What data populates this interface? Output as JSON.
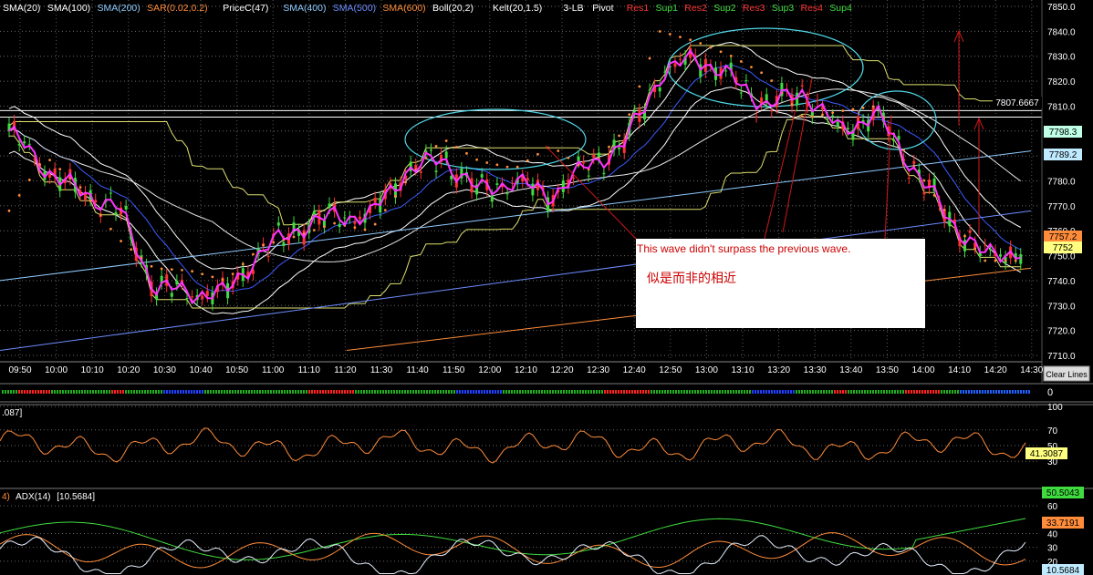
{
  "legend": [
    {
      "text": "SMA(20)",
      "color": "#ffffff"
    },
    {
      "text": "SMA(100)",
      "color": "#ffffff"
    },
    {
      "text": "SMA(200)",
      "color": "#8ecbff"
    },
    {
      "text": "SAR(0.02,0.2)",
      "color": "#ff8c3a"
    },
    {
      "text": "PriceC(47)",
      "color": "#ffffff"
    },
    {
      "text": "SMA(400)",
      "color": "#8ecbff"
    },
    {
      "text": "SMA(500)",
      "color": "#6d8cff"
    },
    {
      "text": "SMA(600)",
      "color": "#ff8c3a"
    },
    {
      "text": "Boll(20,2)",
      "color": "#ffffff"
    },
    {
      "text": "Kelt(20,1.5)",
      "color": "#ffffff"
    },
    {
      "text": "3-LB",
      "color": "#ffffff"
    },
    {
      "text": "Pivot",
      "color": "#ffffff"
    },
    {
      "text": "Res1",
      "color": "#ff3333"
    },
    {
      "text": "Sup1",
      "color": "#3fdc3f"
    },
    {
      "text": "Res2",
      "color": "#ff3333"
    },
    {
      "text": "Sup2",
      "color": "#3fdc3f"
    },
    {
      "text": "Res3",
      "color": "#ff3333"
    },
    {
      "text": "Sup3",
      "color": "#3fdc3f"
    },
    {
      "text": "Res4",
      "color": "#ff3333"
    },
    {
      "text": "Sup4",
      "color": "#3fdc3f"
    }
  ],
  "price_axis_ticks": [
    "7850.0",
    "7840.0",
    "7830.0",
    "7820.0",
    "7810.0",
    "7800.0",
    "7790.0",
    "7780.0",
    "7770.0",
    "7760.0",
    "7750.0",
    "7740.0",
    "7730.0",
    "7720.0",
    "7710.0"
  ],
  "price_tags": [
    {
      "text": "7807.6667",
      "bg": "#000000",
      "fg": "#ffffff"
    },
    {
      "text": "7798.3",
      "bg": "#bfffe6",
      "fg": "#000000"
    },
    {
      "text": "7789.2",
      "bg": "#bfeaff",
      "fg": "#000000"
    },
    {
      "text": "7757.2",
      "bg": "#ff8c3a",
      "fg": "#000000"
    },
    {
      "text": "7752",
      "bg": "#ffff80",
      "fg": "#000000"
    }
  ],
  "time_axis_ticks": [
    "09:50",
    "10:00",
    "10:10",
    "10:20",
    "10:30",
    "10:40",
    "10:50",
    "11:00",
    "11:10",
    "11:20",
    "11:30",
    "11:40",
    "11:50",
    "12:00",
    "12:10",
    "12:20",
    "12:30",
    "12:40",
    "12:50",
    "13:00",
    "13:10",
    "13:20",
    "13:30",
    "13:40",
    "13:50",
    "14:00",
    "14:10",
    "14:20",
    "14:30"
  ],
  "clear_lines_label": "Clear Lines",
  "annotation": {
    "line1": "This wave didn't surpass the previous wave.",
    "line2": "似是而非的相近"
  },
  "pane_3lb": {
    "axis_label": "0"
  },
  "pane_rsi": {
    "header": ".087]",
    "ticks": [
      "100",
      "70",
      "50",
      "30"
    ],
    "value_tag": "41.3087"
  },
  "pane_adx": {
    "header_prefix": "4)",
    "header_name": "ADX(14)",
    "header_value": "[10.5684]",
    "ticks": [
      "60",
      "40",
      "30",
      "20"
    ],
    "tags": [
      {
        "text": "50.5043",
        "bg": "#3fdc3f"
      },
      {
        "text": "33.7191",
        "bg": "#ff8c3a"
      },
      {
        "text": "10.5684",
        "bg": "#bfeaff"
      }
    ]
  },
  "chart_data": {
    "type": "line",
    "title": "",
    "xlabel": "",
    "ylabel": "",
    "ylim": [
      7705,
      7852
    ],
    "x": [
      "09:50",
      "10:00",
      "10:10",
      "10:20",
      "10:30",
      "10:40",
      "10:50",
      "11:00",
      "11:10",
      "11:20",
      "11:30",
      "11:40",
      "11:50",
      "12:00",
      "12:10",
      "12:20",
      "12:30",
      "12:40",
      "12:50",
      "13:00",
      "13:10",
      "13:20",
      "13:30",
      "13:40",
      "13:50",
      "14:00",
      "14:10",
      "14:20",
      "14:25"
    ],
    "series": [
      {
        "name": "",
        "color": "#ff33ff",
        "values": [
          7800,
          7785,
          7775,
          7770,
          7738,
          7735,
          7735,
          7752,
          7761,
          7766,
          7766,
          7784,
          7789,
          7776,
          7780,
          7774,
          7786,
          7794,
          7822,
          7830,
          7821,
          7810,
          7816,
          7800,
          7807,
          7786,
          7765,
          7750,
          7752
        ]
      }
    ],
    "sar_values": [
      7768,
      7790,
      7777,
      7757,
      7745,
      7744,
      7740,
      7754,
      7758,
      7763,
      7760,
      7780,
      7797,
      7788,
      7785,
      7794,
      7784,
      7800,
      7840,
      7836,
      7830,
      7822,
      7805,
      7808,
      7810,
      7787,
      7766,
      7748,
      7748
    ],
    "rsi": {
      "ylim": [
        0,
        100
      ],
      "last": 41.3087
    },
    "adx": {
      "ylim": [
        10,
        70
      ],
      "adx": 10.5684,
      "plus_di": 50.5043,
      "minus_di": 33.7191
    },
    "grid": true,
    "legend_position": "top-left"
  }
}
